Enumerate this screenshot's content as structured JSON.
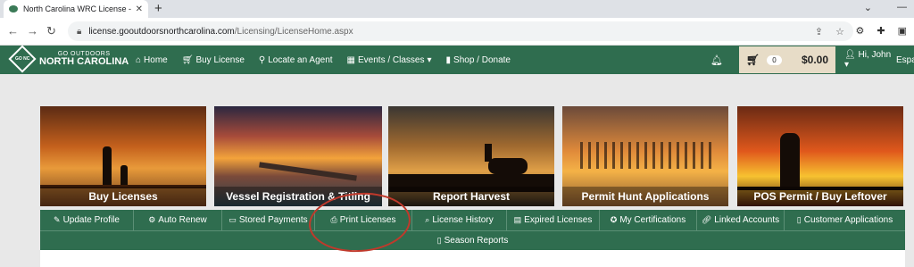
{
  "browser": {
    "tab_title": "North Carolina WRC License - Lic",
    "url_host": "license.gooutdoorsnorthcarolina.com",
    "url_path": "/Licensing/LicenseHome.aspx"
  },
  "site": {
    "logo_small": "GO OUTDOORS",
    "logo_big": "NORTH CAROLINA",
    "logo_badge": "GO NC",
    "nav": [
      {
        "label": "Home",
        "icon": "home-icon"
      },
      {
        "label": "Buy License",
        "icon": "cart-icon"
      },
      {
        "label": "Locate an Agent",
        "icon": "map-marker-icon"
      },
      {
        "label": "Events / Classes",
        "icon": "calendar-icon"
      },
      {
        "label": "Shop / Donate",
        "icon": "shopping-bag-icon"
      }
    ],
    "cart_count": "0",
    "cart_total": "$0.00",
    "user": "Hi, John",
    "lang": "Espa"
  },
  "tiles": [
    {
      "label": "Buy Licenses"
    },
    {
      "label": "Vessel Registration & Titling"
    },
    {
      "label": "Report Harvest"
    },
    {
      "label": "Permit Hunt Applications"
    },
    {
      "label": "POS Permit / Buy Leftover"
    }
  ],
  "actions": [
    {
      "label": "Update Profile",
      "icon": "edit-icon"
    },
    {
      "label": "Auto Renew",
      "icon": "gear-icon"
    },
    {
      "label": "Stored Payments",
      "icon": "credit-card-icon"
    },
    {
      "label": "Print Licenses",
      "icon": "printer-icon"
    },
    {
      "label": "License History",
      "icon": "search-icon"
    },
    {
      "label": "Expired Licenses",
      "icon": "archive-icon"
    },
    {
      "label": "My Certifications",
      "icon": "certificate-icon"
    },
    {
      "label": "Linked Accounts",
      "icon": "link-icon"
    },
    {
      "label": "Customer Applications",
      "icon": "document-icon"
    }
  ],
  "actions_row2": [
    {
      "label": "Season Reports",
      "icon": "document-icon"
    }
  ],
  "colors": {
    "brand_green": "#2f6d4f",
    "cart_bg": "#e7dcc7",
    "annotation_red": "#c0392b"
  }
}
